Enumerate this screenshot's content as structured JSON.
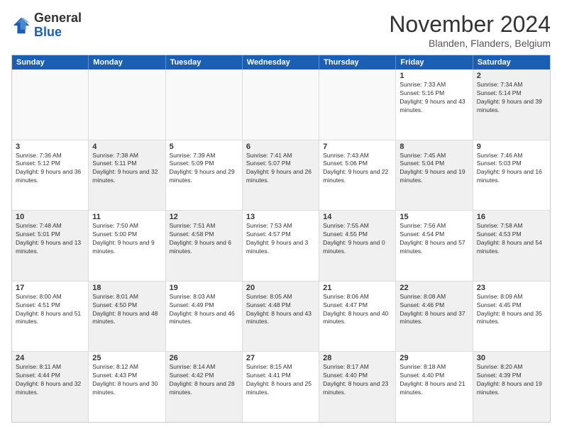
{
  "header": {
    "logo_general": "General",
    "logo_blue": "Blue",
    "title": "November 2024",
    "subtitle": "Blanden, Flanders, Belgium"
  },
  "calendar": {
    "days_of_week": [
      "Sunday",
      "Monday",
      "Tuesday",
      "Wednesday",
      "Thursday",
      "Friday",
      "Saturday"
    ],
    "rows": [
      [
        {
          "day": "",
          "empty": true
        },
        {
          "day": "",
          "empty": true
        },
        {
          "day": "",
          "empty": true
        },
        {
          "day": "",
          "empty": true
        },
        {
          "day": "",
          "empty": true
        },
        {
          "day": "1",
          "sunrise": "Sunrise: 7:33 AM",
          "sunset": "Sunset: 5:16 PM",
          "daylight": "Daylight: 9 hours and 43 minutes.",
          "shaded": false
        },
        {
          "day": "2",
          "sunrise": "Sunrise: 7:34 AM",
          "sunset": "Sunset: 5:14 PM",
          "daylight": "Daylight: 9 hours and 39 minutes.",
          "shaded": true
        }
      ],
      [
        {
          "day": "3",
          "sunrise": "Sunrise: 7:36 AM",
          "sunset": "Sunset: 5:12 PM",
          "daylight": "Daylight: 9 hours and 36 minutes.",
          "shaded": false
        },
        {
          "day": "4",
          "sunrise": "Sunrise: 7:38 AM",
          "sunset": "Sunset: 5:11 PM",
          "daylight": "Daylight: 9 hours and 32 minutes.",
          "shaded": true
        },
        {
          "day": "5",
          "sunrise": "Sunrise: 7:39 AM",
          "sunset": "Sunset: 5:09 PM",
          "daylight": "Daylight: 9 hours and 29 minutes.",
          "shaded": false
        },
        {
          "day": "6",
          "sunrise": "Sunrise: 7:41 AM",
          "sunset": "Sunset: 5:07 PM",
          "daylight": "Daylight: 9 hours and 26 minutes.",
          "shaded": true
        },
        {
          "day": "7",
          "sunrise": "Sunrise: 7:43 AM",
          "sunset": "Sunset: 5:06 PM",
          "daylight": "Daylight: 9 hours and 22 minutes.",
          "shaded": false
        },
        {
          "day": "8",
          "sunrise": "Sunrise: 7:45 AM",
          "sunset": "Sunset: 5:04 PM",
          "daylight": "Daylight: 9 hours and 19 minutes.",
          "shaded": true
        },
        {
          "day": "9",
          "sunrise": "Sunrise: 7:46 AM",
          "sunset": "Sunset: 5:03 PM",
          "daylight": "Daylight: 9 hours and 16 minutes.",
          "shaded": false
        }
      ],
      [
        {
          "day": "10",
          "sunrise": "Sunrise: 7:48 AM",
          "sunset": "Sunset: 5:01 PM",
          "daylight": "Daylight: 9 hours and 13 minutes.",
          "shaded": true
        },
        {
          "day": "11",
          "sunrise": "Sunrise: 7:50 AM",
          "sunset": "Sunset: 5:00 PM",
          "daylight": "Daylight: 9 hours and 9 minutes.",
          "shaded": false
        },
        {
          "day": "12",
          "sunrise": "Sunrise: 7:51 AM",
          "sunset": "Sunset: 4:58 PM",
          "daylight": "Daylight: 9 hours and 6 minutes.",
          "shaded": true
        },
        {
          "day": "13",
          "sunrise": "Sunrise: 7:53 AM",
          "sunset": "Sunset: 4:57 PM",
          "daylight": "Daylight: 9 hours and 3 minutes.",
          "shaded": false
        },
        {
          "day": "14",
          "sunrise": "Sunrise: 7:55 AM",
          "sunset": "Sunset: 4:55 PM",
          "daylight": "Daylight: 9 hours and 0 minutes.",
          "shaded": true
        },
        {
          "day": "15",
          "sunrise": "Sunrise: 7:56 AM",
          "sunset": "Sunset: 4:54 PM",
          "daylight": "Daylight: 8 hours and 57 minutes.",
          "shaded": false
        },
        {
          "day": "16",
          "sunrise": "Sunrise: 7:58 AM",
          "sunset": "Sunset: 4:53 PM",
          "daylight": "Daylight: 8 hours and 54 minutes.",
          "shaded": true
        }
      ],
      [
        {
          "day": "17",
          "sunrise": "Sunrise: 8:00 AM",
          "sunset": "Sunset: 4:51 PM",
          "daylight": "Daylight: 8 hours and 51 minutes.",
          "shaded": false
        },
        {
          "day": "18",
          "sunrise": "Sunrise: 8:01 AM",
          "sunset": "Sunset: 4:50 PM",
          "daylight": "Daylight: 8 hours and 48 minutes.",
          "shaded": true
        },
        {
          "day": "19",
          "sunrise": "Sunrise: 8:03 AM",
          "sunset": "Sunset: 4:49 PM",
          "daylight": "Daylight: 8 hours and 46 minutes.",
          "shaded": false
        },
        {
          "day": "20",
          "sunrise": "Sunrise: 8:05 AM",
          "sunset": "Sunset: 4:48 PM",
          "daylight": "Daylight: 8 hours and 43 minutes.",
          "shaded": true
        },
        {
          "day": "21",
          "sunrise": "Sunrise: 8:06 AM",
          "sunset": "Sunset: 4:47 PM",
          "daylight": "Daylight: 8 hours and 40 minutes.",
          "shaded": false
        },
        {
          "day": "22",
          "sunrise": "Sunrise: 8:08 AM",
          "sunset": "Sunset: 4:46 PM",
          "daylight": "Daylight: 8 hours and 37 minutes.",
          "shaded": true
        },
        {
          "day": "23",
          "sunrise": "Sunrise: 8:09 AM",
          "sunset": "Sunset: 4:45 PM",
          "daylight": "Daylight: 8 hours and 35 minutes.",
          "shaded": false
        }
      ],
      [
        {
          "day": "24",
          "sunrise": "Sunrise: 8:11 AM",
          "sunset": "Sunset: 4:44 PM",
          "daylight": "Daylight: 8 hours and 32 minutes.",
          "shaded": true
        },
        {
          "day": "25",
          "sunrise": "Sunrise: 8:12 AM",
          "sunset": "Sunset: 4:43 PM",
          "daylight": "Daylight: 8 hours and 30 minutes.",
          "shaded": false
        },
        {
          "day": "26",
          "sunrise": "Sunrise: 8:14 AM",
          "sunset": "Sunset: 4:42 PM",
          "daylight": "Daylight: 8 hours and 28 minutes.",
          "shaded": true
        },
        {
          "day": "27",
          "sunrise": "Sunrise: 8:15 AM",
          "sunset": "Sunset: 4:41 PM",
          "daylight": "Daylight: 8 hours and 25 minutes.",
          "shaded": false
        },
        {
          "day": "28",
          "sunrise": "Sunrise: 8:17 AM",
          "sunset": "Sunset: 4:40 PM",
          "daylight": "Daylight: 8 hours and 23 minutes.",
          "shaded": true
        },
        {
          "day": "29",
          "sunrise": "Sunrise: 8:18 AM",
          "sunset": "Sunset: 4:40 PM",
          "daylight": "Daylight: 8 hours and 21 minutes.",
          "shaded": false
        },
        {
          "day": "30",
          "sunrise": "Sunrise: 8:20 AM",
          "sunset": "Sunset: 4:39 PM",
          "daylight": "Daylight: 8 hours and 19 minutes.",
          "shaded": true
        }
      ]
    ]
  }
}
